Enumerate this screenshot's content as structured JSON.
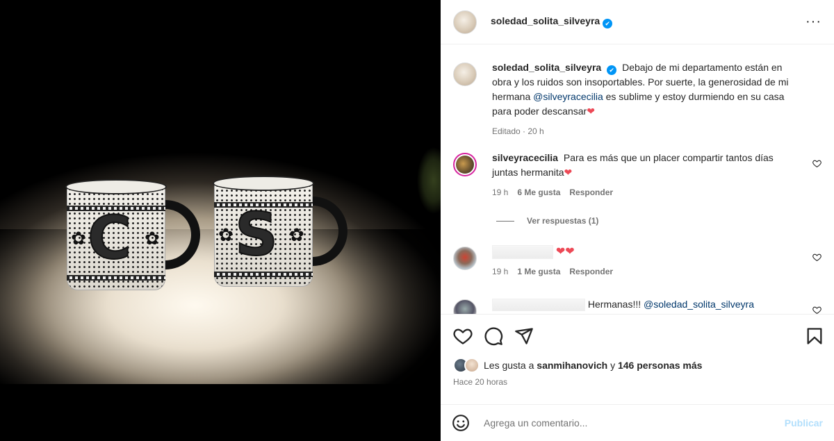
{
  "post": {
    "author": "soledad_solita_silveyra",
    "verified": "✔",
    "menu_icon": "···"
  },
  "caption": {
    "author": "soledad_solita_silveyra",
    "text_before": "Debajo de mi departamento están en obra y los ruidos son insoportables. Por suerte, la generosidad de mi hermana",
    "mention": "@silveyracecilia",
    "text_after": "es sublime y estoy durmiendo en su casa para poder descansar",
    "emoji": "❤",
    "meta": "Editado · 20 h"
  },
  "comments": [
    {
      "author": "silveyracecilia",
      "text": "Para es más que un placer compartir tantos días juntas hermanita",
      "emoji": "❤",
      "time": "19 h",
      "likes": "6 Me gusta",
      "reply": "Responder",
      "view_replies": "Ver respuestas (1)"
    },
    {
      "author": "",
      "text": "❤❤",
      "time": "19 h",
      "likes": "1 Me gusta",
      "reply": "Responder"
    },
    {
      "author": "",
      "text": "Hermanas!!!",
      "mention": "@soledad_solita_silveyra"
    }
  ],
  "likes": {
    "prefix": "Les gusta a",
    "user": "sanmihanovich",
    "conj": "y",
    "others": "146 personas más"
  },
  "date": "Hace 20 horas",
  "add_comment": {
    "placeholder": "Agrega un comentario...",
    "submit": "Publicar"
  },
  "photo": {
    "mug_left_letter": "C",
    "mug_right_letter": "S"
  },
  "colors": {
    "link": "#00376b",
    "verified": "#0095f6",
    "heart": "#ed4956",
    "submit_disabled": "#b2dffc"
  },
  "icons": [
    "heart-icon",
    "comment-icon",
    "share-icon",
    "bookmark-icon",
    "emoji-icon",
    "more-icon",
    "verified-icon"
  ]
}
